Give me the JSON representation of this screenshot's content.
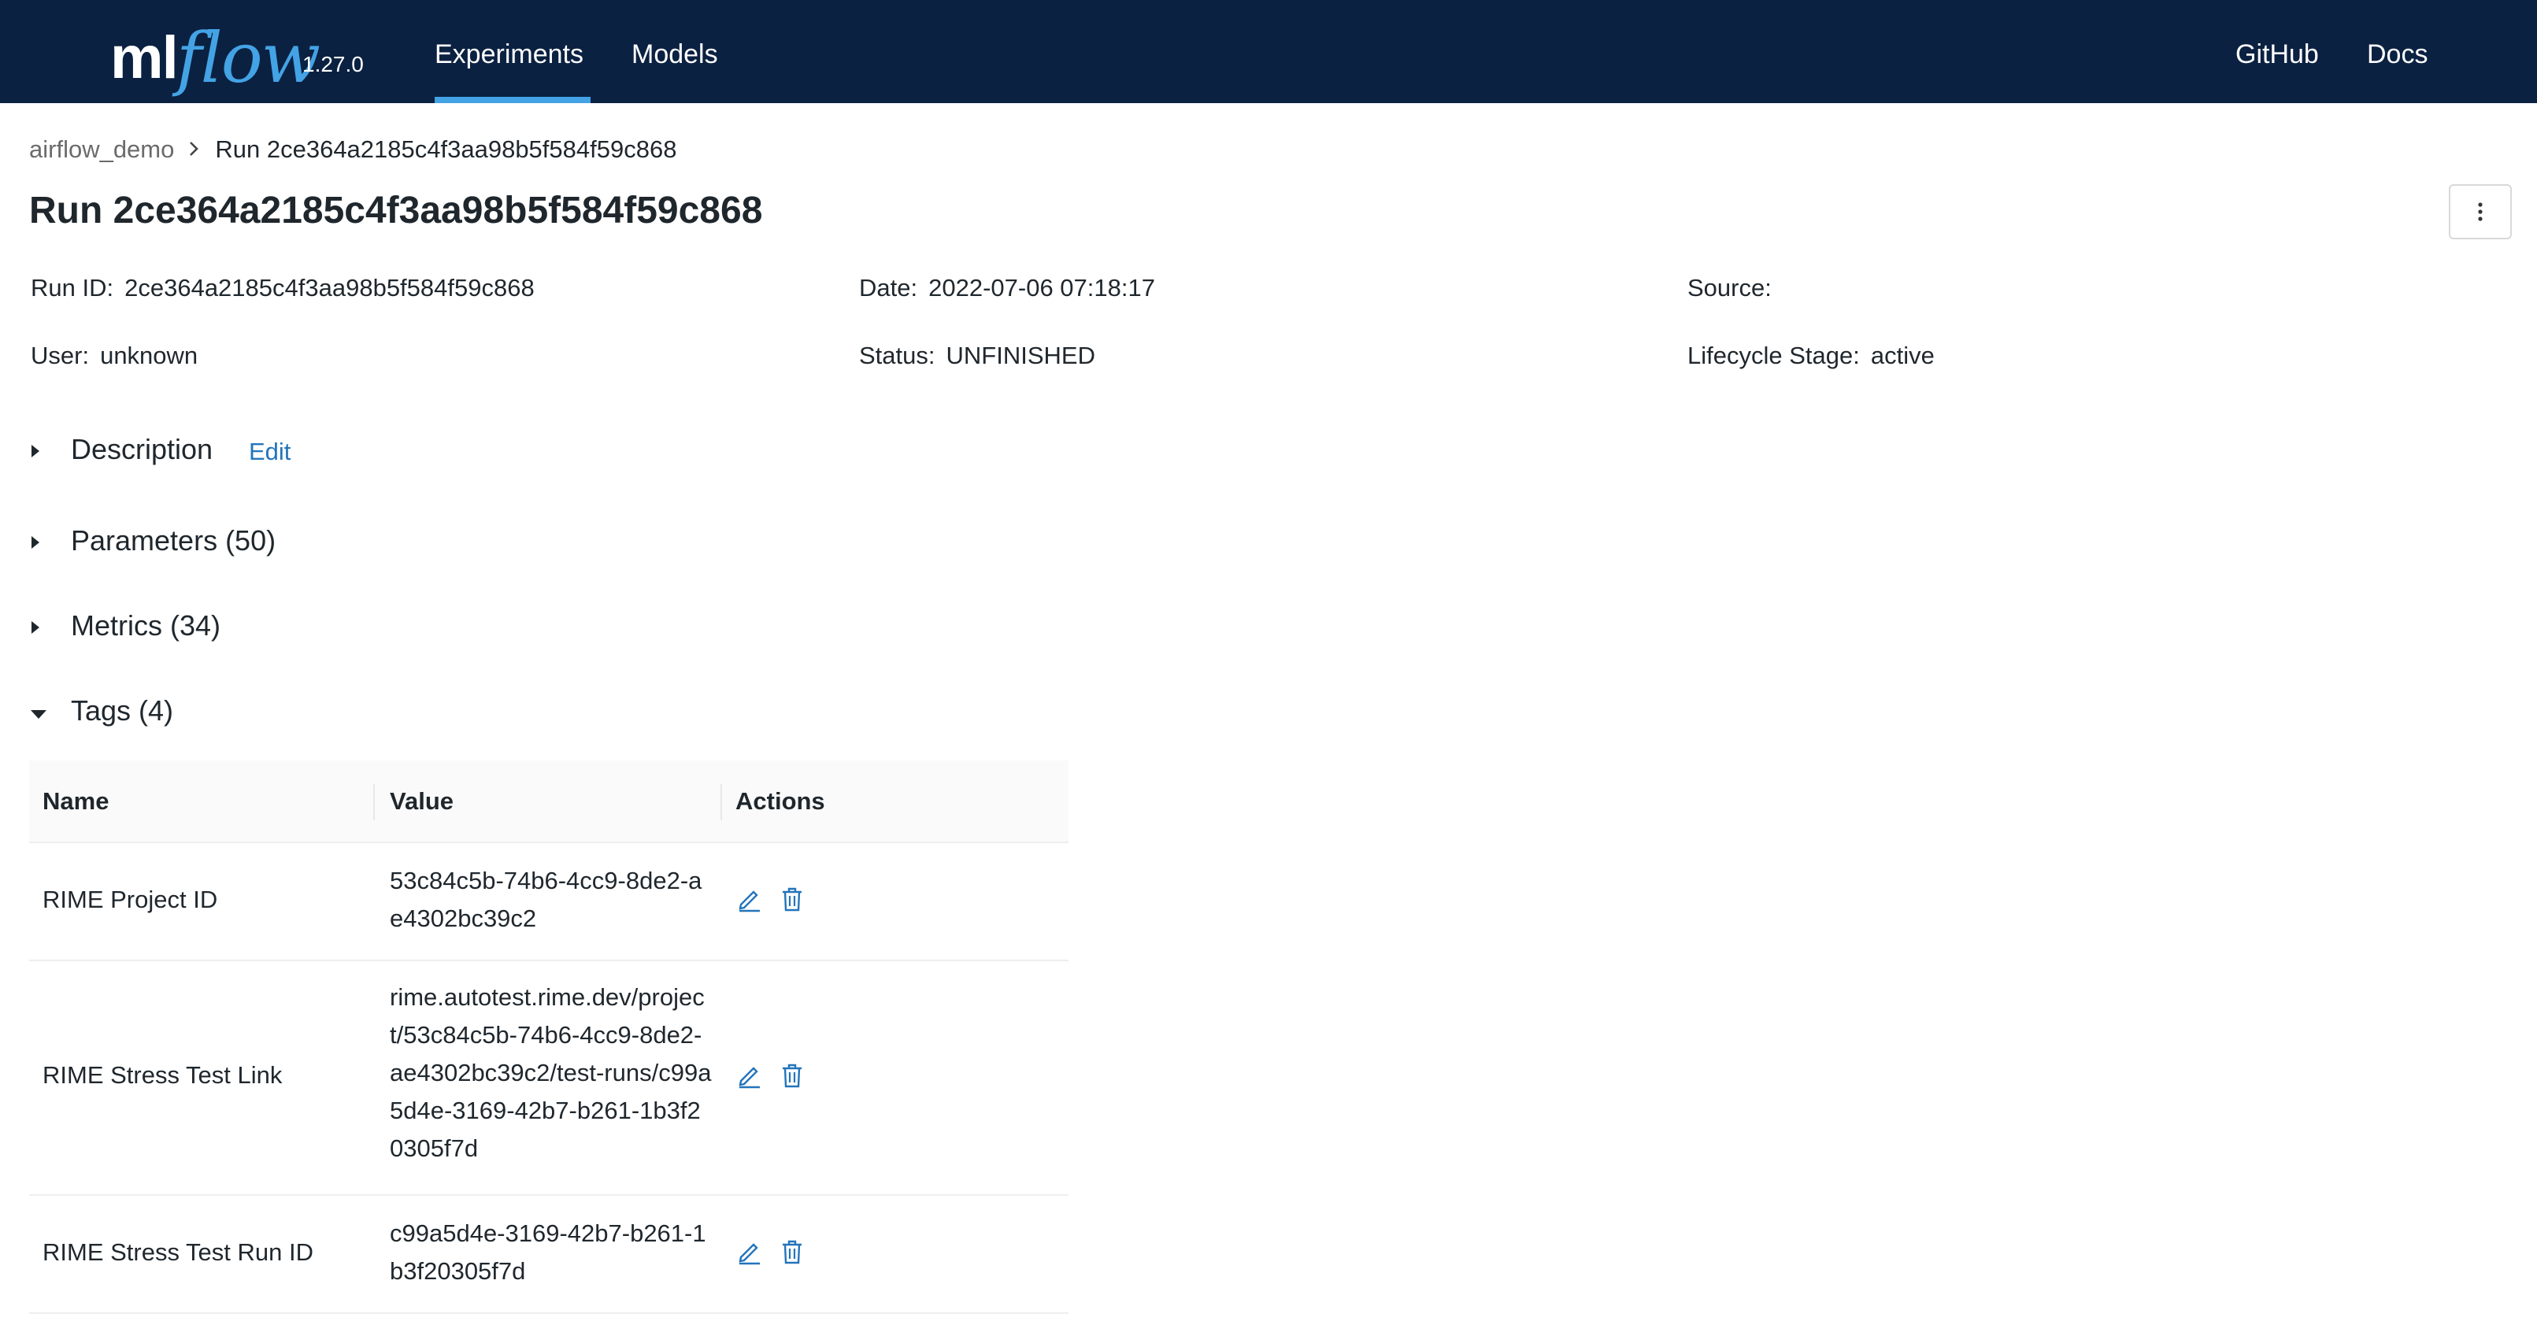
{
  "app": {
    "logo_ml": "ml",
    "logo_flow": "flow",
    "version": "1.27.0",
    "accent_color": "#43a3e5",
    "header_color": "#0b2142"
  },
  "nav": {
    "experiments": "Experiments",
    "models": "Models",
    "github": "GitHub",
    "docs": "Docs",
    "active": "Experiments"
  },
  "breadcrumb": {
    "parent": "airflow_demo",
    "separator_icon": "chevron-right-icon",
    "current": "Run 2ce364a2185c4f3aa98b5f584f59c868"
  },
  "page": {
    "title": "Run 2ce364a2185c4f3aa98b5f584f59c868",
    "overflow_icon": "vertical-ellipsis-icon"
  },
  "meta": {
    "run_id_label": "Run ID:",
    "run_id": "2ce364a2185c4f3aa98b5f584f59c868",
    "date_label": "Date:",
    "date": "2022-07-06 07:18:17",
    "source_label": "Source:",
    "source": "",
    "user_label": "User:",
    "user": "unknown",
    "status_label": "Status:",
    "status": "UNFINISHED",
    "lifecycle_label": "Lifecycle Stage:",
    "lifecycle": "active"
  },
  "sections": {
    "description": "Description",
    "description_edit": "Edit",
    "parameters": "Parameters (50)",
    "metrics": "Metrics (34)",
    "tags": "Tags (4)"
  },
  "tags_table": {
    "columns": [
      "Name",
      "Value",
      "Actions"
    ],
    "rows": [
      {
        "name": "RIME Project ID",
        "value": "53c84c5b-74b6-4cc9-8de2-ae4302bc39c2"
      },
      {
        "name": "RIME Stress Test Link",
        "value": "rime.autotest.rime.dev/project/53c84c5b-74b6-4cc9-8de2-ae4302bc39c2/test-runs/c99a5d4e-3169-42b7-b261-1b3f20305f7d"
      },
      {
        "name": "RIME Stress Test Run ID",
        "value": "c99a5d4e-3169-42b7-b261-1b3f20305f7d"
      }
    ]
  }
}
